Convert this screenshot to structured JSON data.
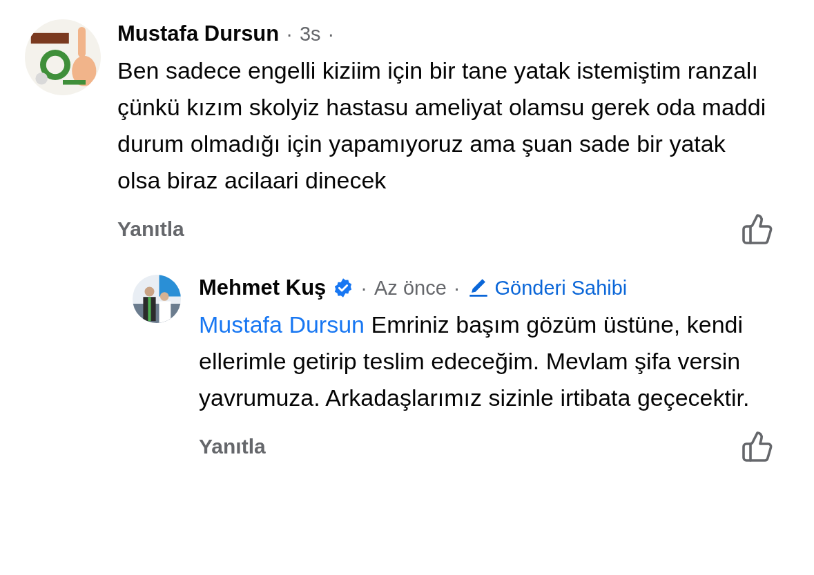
{
  "separator": "·",
  "comments": [
    {
      "author": "Mustafa Dursun",
      "verified": false,
      "time": "3s",
      "text": "Ben sadece engelli kiziim için bir tane yatak istemiştim ranzalı çünkü kızım skolyiz hastasu ameliyat olamsu gerek oda maddi durum olmadığı için yapamıyoruz ama şuan sade bir yatak olsa biraz acilaari dinecek",
      "reply_label": "Yanıtla",
      "reply": false
    },
    {
      "author": "Mehmet Kuş",
      "verified": true,
      "time": "Az önce",
      "owner_label": "Gönderi Sahibi",
      "mention": "Mustafa Dursun",
      "text": "Emriniz başım gözüm üstüne, kendi ellerimle getirip teslim edeceğim. Mevlam şifa versin yavrumuza. Arkadaşlarımız sizinle irtibata geçecektir.",
      "reply_label": "Yanıtla",
      "reply": true
    }
  ]
}
